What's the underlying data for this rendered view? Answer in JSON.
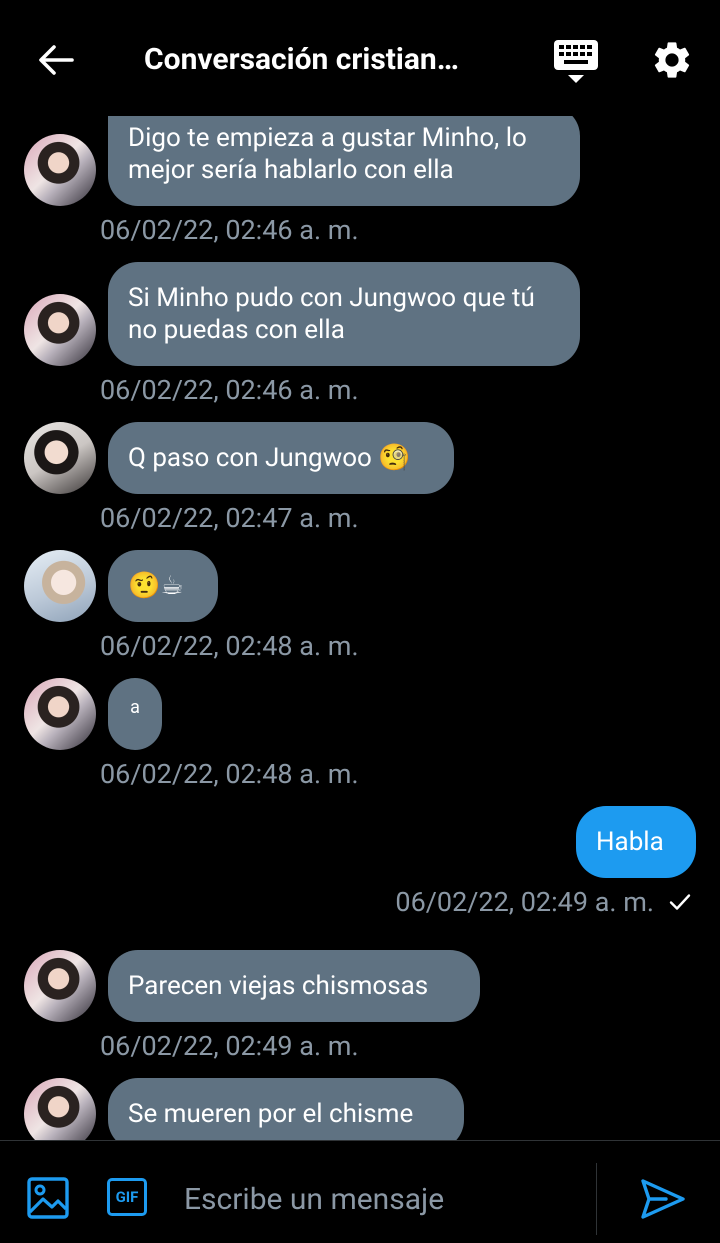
{
  "header": {
    "title": "Conversación cristian…",
    "back_icon": "arrow-left-icon",
    "keyboard_icon": "keyboard-icon",
    "settings_icon": "gear-icon"
  },
  "messages": [
    {
      "direction": "in",
      "avatar": "a",
      "text": "Digo te empieza a gustar Minho, lo mejor sería hablarlo con ella",
      "time": "06/02/22, 02:46 a. m."
    },
    {
      "direction": "in",
      "avatar": "a",
      "text": "Si Minho pudo con Jungwoo que tú no puedas con ella",
      "time": "06/02/22, 02:46 a. m."
    },
    {
      "direction": "in",
      "avatar": "b",
      "text": "Q paso con Jungwoo 🧐",
      "time": "06/02/22, 02:47 a. m."
    },
    {
      "direction": "in",
      "avatar": "c",
      "text": "🤨☕",
      "time": "06/02/22, 02:48 a. m."
    },
    {
      "direction": "in",
      "avatar": "a",
      "text": "a",
      "time": "06/02/22, 02:48 a. m."
    },
    {
      "direction": "out",
      "text": "Habla",
      "time": "06/02/22, 02:49 a. m.",
      "status": "sent"
    },
    {
      "direction": "in",
      "avatar": "a",
      "text": "Parecen viejas chismosas",
      "time": "06/02/22, 02:49 a. m."
    },
    {
      "direction": "in",
      "avatar": "a",
      "text": "Se mueren por el chisme",
      "time": ""
    }
  ],
  "composer": {
    "placeholder": "Escribe un mensaje",
    "value": "",
    "gif_label": "GIF",
    "image_icon": "image-icon",
    "send_icon": "send-icon"
  },
  "colors": {
    "background": "#000000",
    "incoming_bubble": "#5f7282",
    "outgoing_bubble": "#1d9bf0",
    "timestamp": "#8b98a5",
    "accent": "#1d9bf0"
  }
}
